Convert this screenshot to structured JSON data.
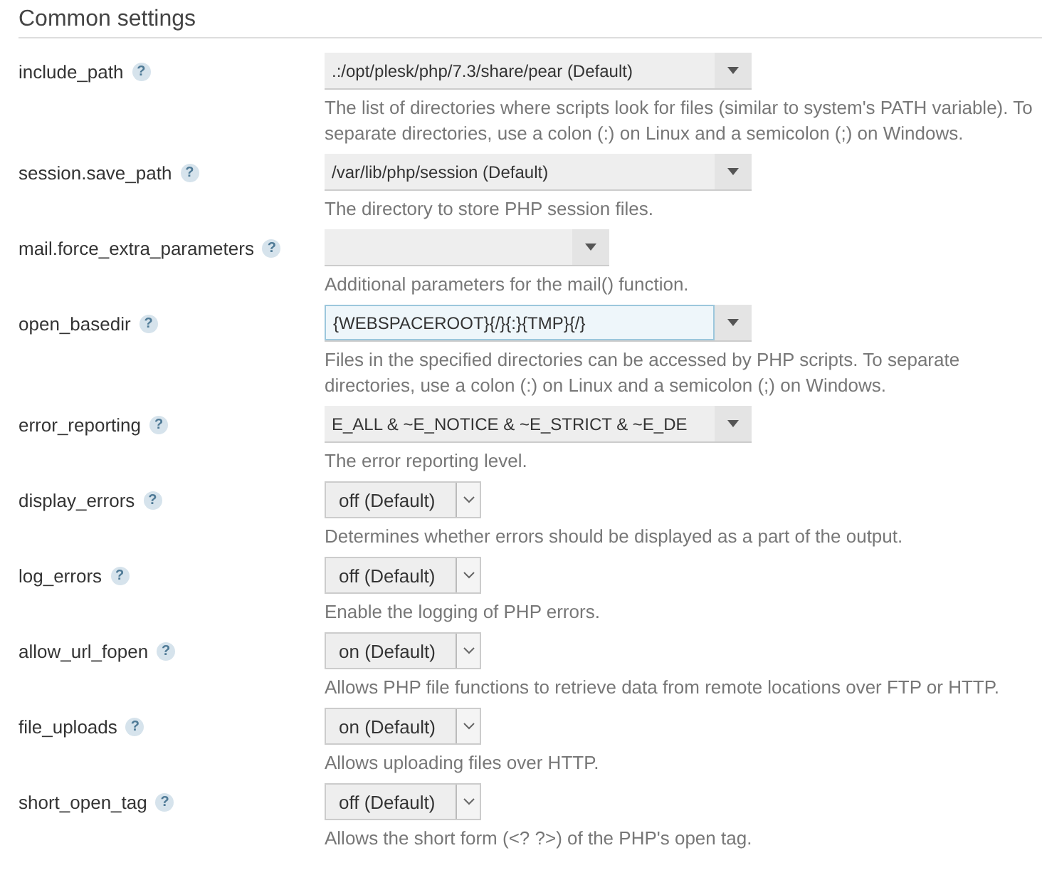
{
  "section": {
    "title": "Common settings"
  },
  "settings": [
    {
      "help": "?",
      "name": "include_path",
      "kind": "combo",
      "value": ".:/opt/plesk/php/7.3/share/pear (Default)",
      "focused": false,
      "description": "The list of directories where scripts look for files (similar to system's PATH variable). To separate directories, use a colon (:) on Linux and a semicolon (;) on Windows."
    },
    {
      "help": "?",
      "name": "session.save_path",
      "kind": "combo",
      "value": "/var/lib/php/session (Default)",
      "focused": false,
      "description": "The directory to store PHP session files."
    },
    {
      "help": "?",
      "name": "mail.force_extra_parameters",
      "kind": "short_combo",
      "focused": false,
      "description": "Additional parameters for the mail() function."
    },
    {
      "help": "?",
      "name": "open_basedir",
      "kind": "combo",
      "value": "{WEBSPACEROOT}{/}{:}{TMP}{/}",
      "focused": true,
      "description": "Files in the specified directories can be accessed by PHP scripts. To separate directories, use a colon (:) on Linux and a semicolon (;) on Windows."
    },
    {
      "help": "?",
      "name": "error_reporting",
      "kind": "combo",
      "value": "E_ALL & ~E_NOTICE & ~E_STRICT & ~E_DE",
      "focused": false,
      "description": "The error reporting level."
    },
    {
      "help": "?",
      "name": "display_errors",
      "kind": "select",
      "value": "off (Default)",
      "description": "Determines whether errors should be displayed as a part of the output."
    },
    {
      "help": "?",
      "name": "log_errors",
      "kind": "select",
      "value": "off (Default)",
      "description": "Enable the logging of PHP errors."
    },
    {
      "help": "?",
      "name": "allow_url_fopen",
      "kind": "select",
      "value": "on (Default)",
      "description": "Allows PHP file functions to retrieve data from remote locations over FTP or HTTP."
    },
    {
      "help": "?",
      "name": "file_uploads",
      "kind": "select",
      "value": "on (Default)",
      "description": "Allows uploading files over HTTP."
    },
    {
      "help": "?",
      "name": "short_open_tag",
      "kind": "select",
      "value": "off (Default)",
      "description": "Allows the short form (<? ?>) of the PHP's open tag."
    }
  ]
}
